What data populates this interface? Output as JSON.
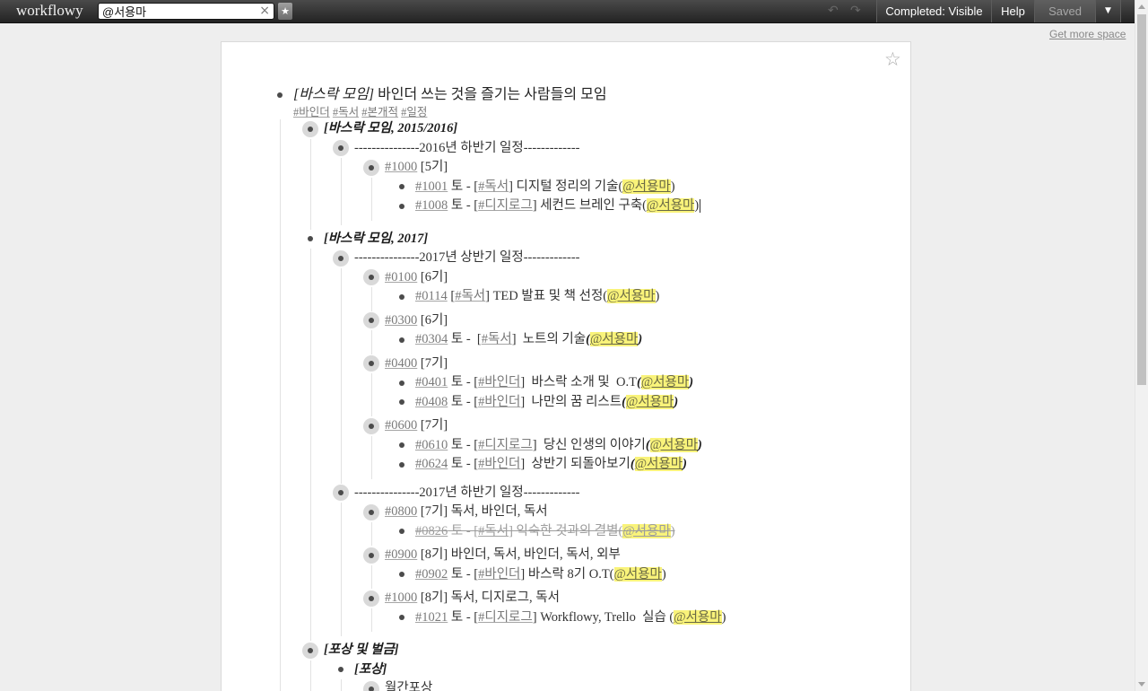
{
  "app": {
    "logo": "workflowy"
  },
  "search": {
    "value": "@서용마",
    "clear_label": "×",
    "star_label": "★"
  },
  "toolbar": {
    "undo_label": "↶",
    "redo_label": "↷",
    "completed_label": "Completed: Visible",
    "help_label": "Help",
    "saved_label": "Saved",
    "menu_label": "▼"
  },
  "links": {
    "more_space": "Get more space"
  },
  "panel": {
    "star_label": "☆"
  },
  "colors": {
    "mention_highlight": "#f9f37a"
  },
  "scrollbar": {
    "visible_fraction": 0.56,
    "position": 0
  },
  "tree": [
    {
      "ring": false,
      "segs": [
        {
          "t": "i",
          "v": "[바스락 모임]"
        },
        {
          "t": "x",
          "v": " 바인더 쓰는 것을 즐기는 사람들의 모임"
        }
      ],
      "note": [
        {
          "t": "tag",
          "v": "#바인더"
        },
        {
          "t": "x",
          "v": " "
        },
        {
          "t": "tag",
          "v": "#독서"
        },
        {
          "t": "x",
          "v": " "
        },
        {
          "t": "tag",
          "v": "#본개적"
        },
        {
          "t": "x",
          "v": " "
        },
        {
          "t": "tag",
          "v": "#일정"
        }
      ],
      "children": [
        {
          "ring": true,
          "segs": [
            {
              "t": "bi",
              "v": "[바스락 모임, 2015/2016]"
            }
          ],
          "children": [
            {
              "ring": true,
              "segs": [
                {
                  "t": "x",
                  "v": "---------------2016년 하반기 일정-------------"
                }
              ],
              "children": [
                {
                  "ring": true,
                  "segs": [
                    {
                      "t": "tag",
                      "v": "#1000"
                    },
                    {
                      "t": "x",
                      "v": " [5기]"
                    }
                  ],
                  "children": [
                    {
                      "segs": [
                        {
                          "t": "tag",
                          "v": "#1001"
                        },
                        {
                          "t": "x",
                          "v": " 토 - ["
                        },
                        {
                          "t": "tag",
                          "v": "#독서"
                        },
                        {
                          "t": "x",
                          "v": "] 디지털 정리의 기술("
                        },
                        {
                          "t": "m",
                          "v": "@서용마"
                        },
                        {
                          "t": "x",
                          "v": ")"
                        }
                      ]
                    },
                    {
                      "caret": true,
                      "segs": [
                        {
                          "t": "tag",
                          "v": "#1008"
                        },
                        {
                          "t": "x",
                          "v": " 토 - ["
                        },
                        {
                          "t": "tag",
                          "v": "#디지로그"
                        },
                        {
                          "t": "x",
                          "v": "] 세컨드 브레인 구축("
                        },
                        {
                          "t": "m",
                          "v": "@서용마"
                        },
                        {
                          "t": "x",
                          "v": ")"
                        }
                      ]
                    }
                  ]
                }
              ]
            }
          ]
        },
        {
          "ring": false,
          "segs": [
            {
              "t": "bi",
              "v": "[바스락 모임, 2017]"
            }
          ],
          "children": [
            {
              "ring": true,
              "segs": [
                {
                  "t": "x",
                  "v": "---------------2017년 상반기 일정-------------"
                }
              ],
              "children": [
                {
                  "ring": true,
                  "segs": [
                    {
                      "t": "tag",
                      "v": "#0100"
                    },
                    {
                      "t": "x",
                      "v": " [6기]"
                    }
                  ],
                  "children": [
                    {
                      "segs": [
                        {
                          "t": "tag",
                          "v": "#0114"
                        },
                        {
                          "t": "x",
                          "v": " ["
                        },
                        {
                          "t": "tag",
                          "v": "#독서"
                        },
                        {
                          "t": "x",
                          "v": "] TED 발표 및 책 선정("
                        },
                        {
                          "t": "m",
                          "v": "@서용마"
                        },
                        {
                          "t": "x",
                          "v": ")"
                        }
                      ]
                    }
                  ]
                },
                {
                  "ring": true,
                  "segs": [
                    {
                      "t": "tag",
                      "v": "#0300"
                    },
                    {
                      "t": "x",
                      "v": " [6기]"
                    }
                  ],
                  "children": [
                    {
                      "segs": [
                        {
                          "t": "tag",
                          "v": "#0304"
                        },
                        {
                          "t": "x",
                          "v": " 토 -  ["
                        },
                        {
                          "t": "tag",
                          "v": "#독서"
                        },
                        {
                          "t": "x",
                          "v": "]  노트의 기술"
                        },
                        {
                          "t": "bi",
                          "v": "("
                        },
                        {
                          "t": "m",
                          "v": "@서용마"
                        },
                        {
                          "t": "bi",
                          "v": ")"
                        }
                      ]
                    }
                  ]
                },
                {
                  "ring": true,
                  "segs": [
                    {
                      "t": "tag",
                      "v": "#0400"
                    },
                    {
                      "t": "x",
                      "v": " [7기]"
                    }
                  ],
                  "children": [
                    {
                      "segs": [
                        {
                          "t": "tag",
                          "v": "#0401"
                        },
                        {
                          "t": "x",
                          "v": " 토 - ["
                        },
                        {
                          "t": "tag",
                          "v": "#바인더"
                        },
                        {
                          "t": "x",
                          "v": "]  바스락 소개 및  O.T"
                        },
                        {
                          "t": "bi",
                          "v": "("
                        },
                        {
                          "t": "m",
                          "v": "@서용마"
                        },
                        {
                          "t": "bi",
                          "v": ")"
                        }
                      ]
                    },
                    {
                      "segs": [
                        {
                          "t": "tag",
                          "v": "#0408"
                        },
                        {
                          "t": "x",
                          "v": " 토 - ["
                        },
                        {
                          "t": "tag",
                          "v": "#바인더"
                        },
                        {
                          "t": "x",
                          "v": "]  나만의 꿈 리스트"
                        },
                        {
                          "t": "bi",
                          "v": "("
                        },
                        {
                          "t": "m",
                          "v": "@서용마"
                        },
                        {
                          "t": "bi",
                          "v": ")"
                        }
                      ]
                    }
                  ]
                },
                {
                  "ring": true,
                  "segs": [
                    {
                      "t": "tag",
                      "v": "#0600"
                    },
                    {
                      "t": "x",
                      "v": " [7기]"
                    }
                  ],
                  "children": [
                    {
                      "segs": [
                        {
                          "t": "tag",
                          "v": "#0610"
                        },
                        {
                          "t": "x",
                          "v": " 토 - ["
                        },
                        {
                          "t": "tag",
                          "v": "#디지로그"
                        },
                        {
                          "t": "x",
                          "v": "]  당신 인생의 이야기"
                        },
                        {
                          "t": "bi",
                          "v": "("
                        },
                        {
                          "t": "m",
                          "v": "@서용마"
                        },
                        {
                          "t": "bi",
                          "v": ")"
                        }
                      ]
                    },
                    {
                      "segs": [
                        {
                          "t": "tag",
                          "v": "#0624"
                        },
                        {
                          "t": "x",
                          "v": " 토 - ["
                        },
                        {
                          "t": "tag",
                          "v": "#바인더"
                        },
                        {
                          "t": "x",
                          "v": "]  상반기 되돌아보기"
                        },
                        {
                          "t": "bi",
                          "v": "("
                        },
                        {
                          "t": "m",
                          "v": "@서용마"
                        },
                        {
                          "t": "bi",
                          "v": ")"
                        }
                      ]
                    }
                  ]
                }
              ]
            },
            {
              "ring": true,
              "segs": [
                {
                  "t": "x",
                  "v": "---------------2017년 하반기 일정-------------"
                }
              ],
              "children": [
                {
                  "ring": true,
                  "segs": [
                    {
                      "t": "tag",
                      "v": "#0800"
                    },
                    {
                      "t": "x",
                      "v": " [7기] 독서, 바인더, 독서"
                    }
                  ],
                  "children": [
                    {
                      "done": true,
                      "segs": [
                        {
                          "t": "tag",
                          "v": "#0826"
                        },
                        {
                          "t": "x",
                          "v": " 토 - ["
                        },
                        {
                          "t": "tag",
                          "v": "#독서"
                        },
                        {
                          "t": "x",
                          "v": "] 익숙한 것과의 결별("
                        },
                        {
                          "t": "m",
                          "v": "@서용마"
                        },
                        {
                          "t": "x",
                          "v": ")"
                        }
                      ]
                    }
                  ]
                },
                {
                  "ring": true,
                  "segs": [
                    {
                      "t": "tag",
                      "v": "#0900"
                    },
                    {
                      "t": "x",
                      "v": " [8기] 바인더, 독서, 바인더, 독서, 외부"
                    }
                  ],
                  "children": [
                    {
                      "segs": [
                        {
                          "t": "tag",
                          "v": "#0902"
                        },
                        {
                          "t": "x",
                          "v": " 토 - ["
                        },
                        {
                          "t": "tag",
                          "v": "#바인더"
                        },
                        {
                          "t": "x",
                          "v": "] 바스락 8기 O.T("
                        },
                        {
                          "t": "m",
                          "v": "@서용마"
                        },
                        {
                          "t": "x",
                          "v": ")"
                        }
                      ]
                    }
                  ]
                },
                {
                  "ring": true,
                  "segs": [
                    {
                      "t": "tag",
                      "v": "#1000"
                    },
                    {
                      "t": "x",
                      "v": " [8기] 독서, 디지로그, 독서"
                    }
                  ],
                  "children": [
                    {
                      "segs": [
                        {
                          "t": "tag",
                          "v": "#1021"
                        },
                        {
                          "t": "x",
                          "v": " 토 - ["
                        },
                        {
                          "t": "tag",
                          "v": "#디지로그"
                        },
                        {
                          "t": "x",
                          "v": "] Workflowy, Trello  실습 ("
                        },
                        {
                          "t": "m",
                          "v": "@서용마"
                        },
                        {
                          "t": "x",
                          "v": ")"
                        }
                      ]
                    }
                  ]
                }
              ]
            }
          ]
        },
        {
          "ring": true,
          "segs": [
            {
              "t": "bi",
              "v": "[포상 및 벌금]"
            }
          ],
          "children": [
            {
              "ring": false,
              "segs": [
                {
                  "t": "bi",
                  "v": "[포상]"
                }
              ],
              "children": [
                {
                  "ring": true,
                  "segs": [
                    {
                      "t": "x",
                      "v": "월간포상"
                    }
                  ]
                }
              ]
            }
          ]
        }
      ]
    }
  ]
}
